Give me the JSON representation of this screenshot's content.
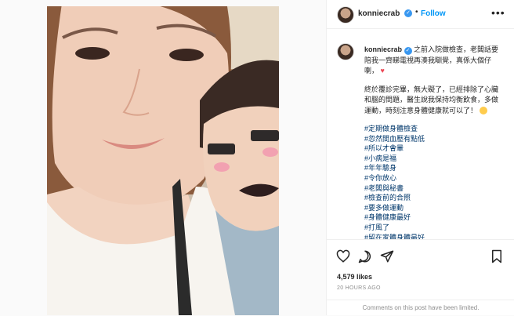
{
  "post": {
    "username": "konniecrab",
    "follow_label": "Follow",
    "more_label": "•••",
    "dot": "•"
  },
  "caption": {
    "username": "konniecrab",
    "line1": "之前入院做檢查，老闆話要陪我一齊睇電視再湊我瞓覺，真係大個仔喇，",
    "line2": "終於覆診完畢，無大礙了，已經排除了心臟和腦的問題，醫生說我保持均衡飲食，多做運動，時刻注意身體健康就可以了！",
    "hashtags": [
      "#定期做身體檢查",
      "#忽然間血壓有點低",
      "#所以才會暈",
      "#小病是福",
      "#年年驗身",
      "#令你放心",
      "#老闆與秘書",
      "#檢查前的合照",
      "#要多做運動",
      "#身體健康最好",
      "#打風了",
      "#留在家體身體最好"
    ]
  },
  "stats": {
    "likes": "4,579 likes",
    "time": "20 HOURS AGO"
  },
  "footer": {
    "comments_off": "Comments on this post have been limited."
  },
  "icons": {
    "heart": "heart-icon",
    "comment": "comment-icon",
    "share": "share-icon",
    "save": "bookmark-icon",
    "verified": "verified-badge-icon"
  },
  "colors": {
    "accent": "#0095f6",
    "verified": "#3897f0",
    "heart": "#ed4956",
    "hashtag": "#00376b"
  }
}
